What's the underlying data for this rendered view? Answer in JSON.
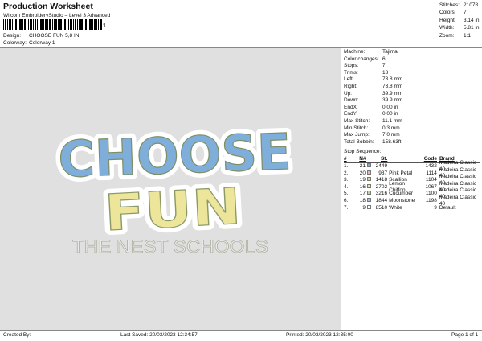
{
  "header": {
    "title": "Production Worksheet",
    "subtitle": "Wilcom EmbroideryStudio – Level 3 Advanced",
    "barcode_mark": "1"
  },
  "meta": {
    "design_label": "Design:",
    "design_value": "CHOOSE FUN 5,8 IN",
    "colorway_label": "Colorway:",
    "colorway_value": "Colorway 1"
  },
  "stats": [
    {
      "k": "Stitches:",
      "v": "21078"
    },
    {
      "k": "Colors:",
      "v": "7"
    },
    {
      "k": "Height:",
      "v": "3.14 in"
    },
    {
      "k": "Width:",
      "v": "5.81 in"
    },
    {
      "k": "Zoom:",
      "v": "1:1"
    }
  ],
  "preview": {
    "word1": "CHOOSE",
    "word2": "FUN",
    "tagline": "THE NEST SCHOOLS"
  },
  "info": [
    {
      "k": "Machine:",
      "v": "Tajima"
    },
    {
      "k": "Color changes:",
      "v": "6"
    },
    {
      "k": "Stops:",
      "v": "7"
    },
    {
      "k": "Trims:",
      "v": "18"
    },
    {
      "k": "Left:",
      "v": "73.8 mm"
    },
    {
      "k": "Right:",
      "v": "73.8 mm"
    },
    {
      "k": "Up:",
      "v": "39.9 mm"
    },
    {
      "k": "Down:",
      "v": "39.9 mm"
    },
    {
      "k": "EndX:",
      "v": "0.00 in"
    },
    {
      "k": "EndY:",
      "v": "0.00 in"
    },
    {
      "k": "Max Stitch:",
      "v": "11.1 mm"
    },
    {
      "k": "Min Stitch:",
      "v": "0.3 mm"
    },
    {
      "k": "Max Jump:",
      "v": "7.0 mm"
    },
    {
      "k": "Total Bobbin:",
      "v": "158.63ft"
    }
  ],
  "sequence": {
    "title": "Stop Sequence:",
    "headers": {
      "num": "#",
      "n": "N#",
      "st": "St.",
      "code": "Code",
      "brand": "Brand"
    },
    "rows": [
      {
        "num": "1.",
        "n": "21",
        "color": "#7eaed9",
        "st": "2449",
        "name": "",
        "code": "1432",
        "brand": "Madeira Classic 40"
      },
      {
        "num": "2.",
        "n": "20",
        "color": "#f2b3b0",
        "st": "937",
        "name": "Pink Petal",
        "code": "1114",
        "brand": "Madeira Classic 40"
      },
      {
        "num": "3.",
        "n": "19",
        "color": "#d6dc94",
        "st": "1418",
        "name": "Scallion",
        "code": "1104",
        "brand": "Madeira Classic 40"
      },
      {
        "num": "4.",
        "n": "16",
        "color": "#f2e7a0",
        "st": "2702",
        "name": "Lemon Chiffon",
        "code": "1067",
        "brand": "Madeira Classic 40"
      },
      {
        "num": "5.",
        "n": "17",
        "color": "#b8d59a",
        "st": "3216",
        "name": "Cucumber",
        "code": "1100",
        "brand": "Madeira Classic 40"
      },
      {
        "num": "6.",
        "n": "18",
        "color": "#a9c3dd",
        "st": "1844",
        "name": "Moonstone",
        "code": "1198",
        "brand": "Madeira Classic 40"
      },
      {
        "num": "7.",
        "n": "9",
        "color": "#ffffff",
        "st": "8510",
        "name": "White",
        "code": "9",
        "brand": "Default"
      }
    ]
  },
  "footer": {
    "created": "Created By:",
    "saved": "Last Saved: 20/03/2023 12:34:57",
    "printed": "Printed: 20/03/2023 12:35:00",
    "page": "Page 1 of 1"
  },
  "colors": {
    "blue": "#7eaed9",
    "pink": "#efc0b0",
    "scallion": "#c9d68c",
    "lemon": "#ece59a",
    "cucumber": "#b3d39a",
    "moonstone": "#a9c3dd",
    "white": "#ffffff",
    "background": "#e0e0e0"
  }
}
